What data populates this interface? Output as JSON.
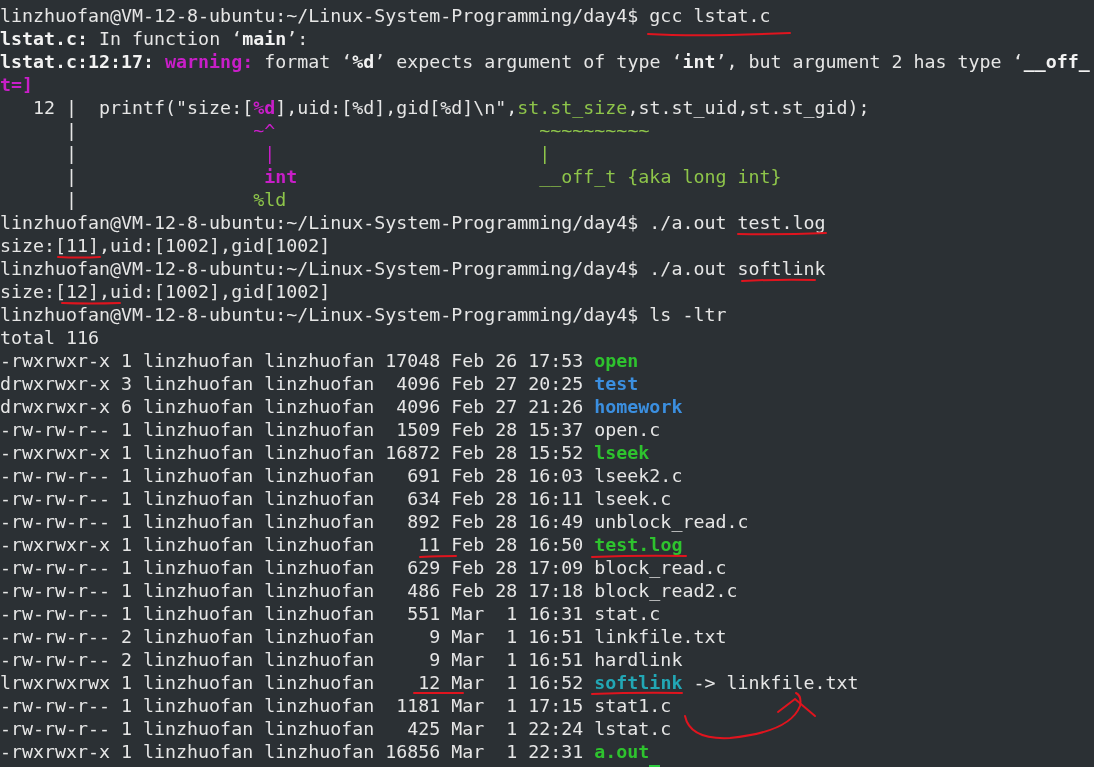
{
  "terminal": {
    "lines": [
      {
        "segments": [
          {
            "text": "linzhuofan@VM-12-8-ubuntu:~/Linux-System-Programming/day4$ gcc lstat.c"
          }
        ]
      },
      {
        "segments": [
          {
            "text": "lstat.c:",
            "kind": "bold"
          },
          {
            "text": " In function ‘"
          },
          {
            "text": "main",
            "kind": "bold"
          },
          {
            "text": "’:"
          }
        ]
      },
      {
        "segments": [
          {
            "text": "lstat.c:12:17: ",
            "kind": "bold"
          },
          {
            "text": "warning:",
            "kind": "warning"
          },
          {
            "text": " format ‘"
          },
          {
            "text": "%d",
            "kind": "bold"
          },
          {
            "text": "’ expects argument of type ‘"
          },
          {
            "text": "int",
            "kind": "bold"
          },
          {
            "text": "’, but argument 2 has type ‘"
          },
          {
            "text": "__off_",
            "kind": "bold"
          }
        ]
      },
      {
        "segments": [
          {
            "text": "t=]",
            "kind": "warning"
          }
        ]
      },
      {
        "segments": [
          {
            "text": "   12 |  printf(\"size:["
          },
          {
            "text": "%d",
            "kind": "warning"
          },
          {
            "text": "],uid:[%d],gid[%d]\\n\","
          },
          {
            "text": "st.st_size",
            "kind": "code"
          },
          {
            "text": ",st.st_uid,st.st_gid);"
          }
        ]
      },
      {
        "segments": [
          {
            "text": "      |                "
          },
          {
            "text": "~^                        ",
            "kind": "marker"
          },
          {
            "text": "~~~~~~~~~~",
            "kind": "code"
          }
        ]
      },
      {
        "segments": [
          {
            "text": "      |                 "
          },
          {
            "text": "|                        ",
            "kind": "marker"
          },
          {
            "text": "|",
            "kind": "code"
          }
        ]
      },
      {
        "segments": [
          {
            "text": "      |                 "
          },
          {
            "text": "int                      ",
            "kind": "warning"
          },
          {
            "text": "__off_t {aka long int}",
            "kind": "code"
          }
        ]
      },
      {
        "segments": [
          {
            "text": "      |                "
          },
          {
            "text": "%ld",
            "kind": "code"
          }
        ]
      },
      {
        "segments": [
          {
            "text": "linzhuofan@VM-12-8-ubuntu:~/Linux-System-Programming/day4$ ./a.out test.log"
          }
        ]
      },
      {
        "segments": [
          {
            "text": "size:[11],uid:[1002],gid[1002]"
          }
        ]
      },
      {
        "segments": [
          {
            "text": "linzhuofan@VM-12-8-ubuntu:~/Linux-System-Programming/day4$ ./a.out softlink"
          }
        ]
      },
      {
        "segments": [
          {
            "text": "size:[12],uid:[1002],gid[1002]"
          }
        ]
      },
      {
        "segments": [
          {
            "text": "linzhuofan@VM-12-8-ubuntu:~/Linux-System-Programming/day4$ ls -ltr"
          }
        ]
      },
      {
        "segments": [
          {
            "text": "total 116"
          }
        ]
      },
      {
        "segments": [
          {
            "text": "-rwxrwxr-x 1 linzhuofan linzhuofan 17048 Feb 26 17:53 "
          },
          {
            "text": "open",
            "kind": "executable"
          }
        ]
      },
      {
        "segments": [
          {
            "text": "drwxrwxr-x 3 linzhuofan linzhuofan  4096 Feb 27 20:25 "
          },
          {
            "text": "test",
            "kind": "directory"
          }
        ]
      },
      {
        "segments": [
          {
            "text": "drwxrwxr-x 6 linzhuofan linzhuofan  4096 Feb 27 21:26 "
          },
          {
            "text": "homework",
            "kind": "directory"
          }
        ]
      },
      {
        "segments": [
          {
            "text": "-rw-rw-r-- 1 linzhuofan linzhuofan  1509 Feb 28 15:37 open.c"
          }
        ]
      },
      {
        "segments": [
          {
            "text": "-rwxrwxr-x 1 linzhuofan linzhuofan 16872 Feb 28 15:52 "
          },
          {
            "text": "lseek",
            "kind": "executable"
          }
        ]
      },
      {
        "segments": [
          {
            "text": "-rw-rw-r-- 1 linzhuofan linzhuofan   691 Feb 28 16:03 lseek2.c"
          }
        ]
      },
      {
        "segments": [
          {
            "text": "-rw-rw-r-- 1 linzhuofan linzhuofan   634 Feb 28 16:11 lseek.c"
          }
        ]
      },
      {
        "segments": [
          {
            "text": "-rw-rw-r-- 1 linzhuofan linzhuofan   892 Feb 28 16:49 unblock_read.c"
          }
        ]
      },
      {
        "segments": [
          {
            "text": "-rwxrwxr-x 1 linzhuofan linzhuofan    11 Feb 28 16:50 "
          },
          {
            "text": "test.log",
            "kind": "executable"
          }
        ]
      },
      {
        "segments": [
          {
            "text": "-rw-rw-r-- 1 linzhuofan linzhuofan   629 Feb 28 17:09 block_read.c"
          }
        ]
      },
      {
        "segments": [
          {
            "text": "-rw-rw-r-- 1 linzhuofan linzhuofan   486 Feb 28 17:18 block_read2.c"
          }
        ]
      },
      {
        "segments": [
          {
            "text": "-rw-rw-r-- 1 linzhuofan linzhuofan   551 Mar  1 16:31 stat.c"
          }
        ]
      },
      {
        "segments": [
          {
            "text": "-rw-rw-r-- 2 linzhuofan linzhuofan     9 Mar  1 16:51 linkfile.txt"
          }
        ]
      },
      {
        "segments": [
          {
            "text": "-rw-rw-r-- 2 linzhuofan linzhuofan     9 Mar  1 16:51 hardlink"
          }
        ]
      },
      {
        "segments": [
          {
            "text": "lrwxrwxrwx 1 linzhuofan linzhuofan    12 Mar  1 16:52 "
          },
          {
            "text": "softlink",
            "kind": "symlink"
          },
          {
            "text": " -> linkfile.txt"
          }
        ]
      },
      {
        "segments": [
          {
            "text": "-rw-rw-r-- 1 linzhuofan linzhuofan  1181 Mar  1 17:15 stat1.c"
          }
        ]
      },
      {
        "segments": [
          {
            "text": "-rw-rw-r-- 1 linzhuofan linzhuofan   425 Mar  1 22:24 lstat.c"
          }
        ]
      },
      {
        "segments": [
          {
            "text": "-rwxrwxr-x 1 linzhuofan linzhuofan 16856 Mar  1 22:31 "
          },
          {
            "text": "a.out",
            "kind": "executable"
          }
        ]
      }
    ]
  }
}
